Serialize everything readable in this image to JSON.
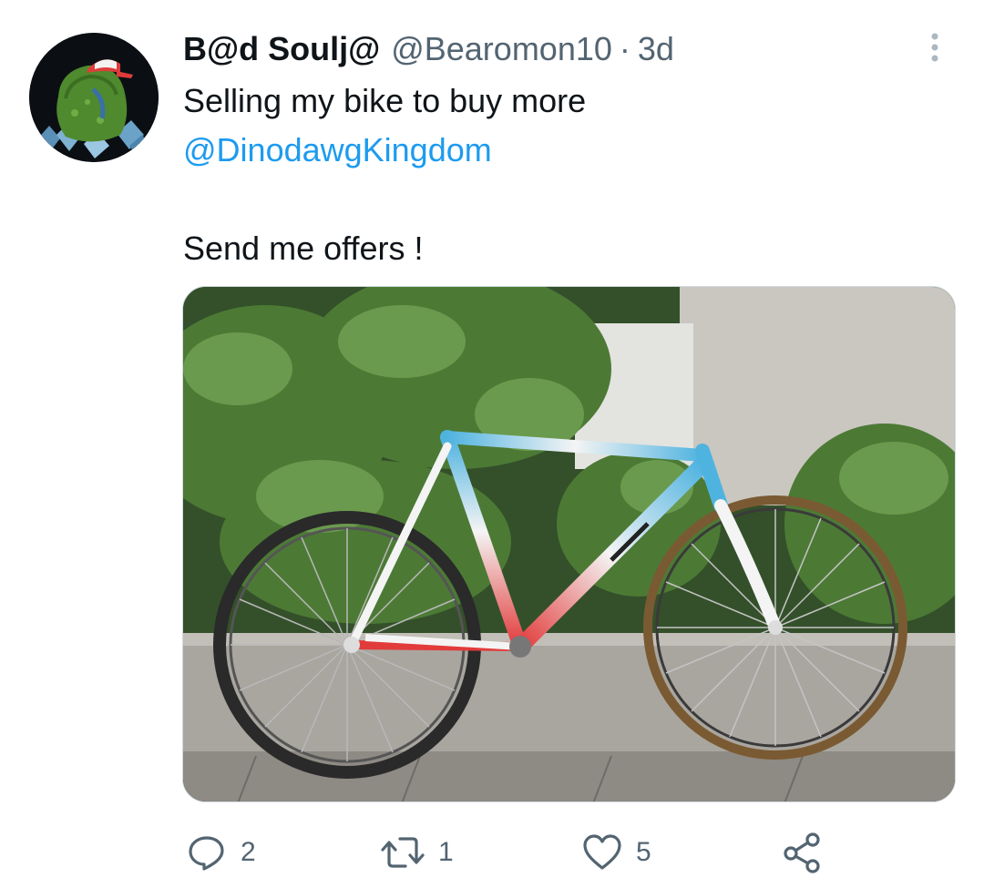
{
  "tweet": {
    "display_name": "B@d Soulj@",
    "handle": "@Bearomon10",
    "separator": "·",
    "time": "3d",
    "text_line_1": "Selling my bike to buy more",
    "mention": "@DinodawgKingdom",
    "text_line_2": "Send me offers !"
  },
  "actions": {
    "reply_count": "2",
    "retweet_count": "1",
    "like_count": "5"
  },
  "icons": {
    "more": "more-vertical-icon",
    "reply": "reply-icon",
    "retweet": "retweet-icon",
    "like": "heart-icon",
    "share": "share-icon"
  },
  "colors": {
    "link": "#1d9bf0",
    "secondary_text": "#536471",
    "primary_text": "#0f1419"
  }
}
